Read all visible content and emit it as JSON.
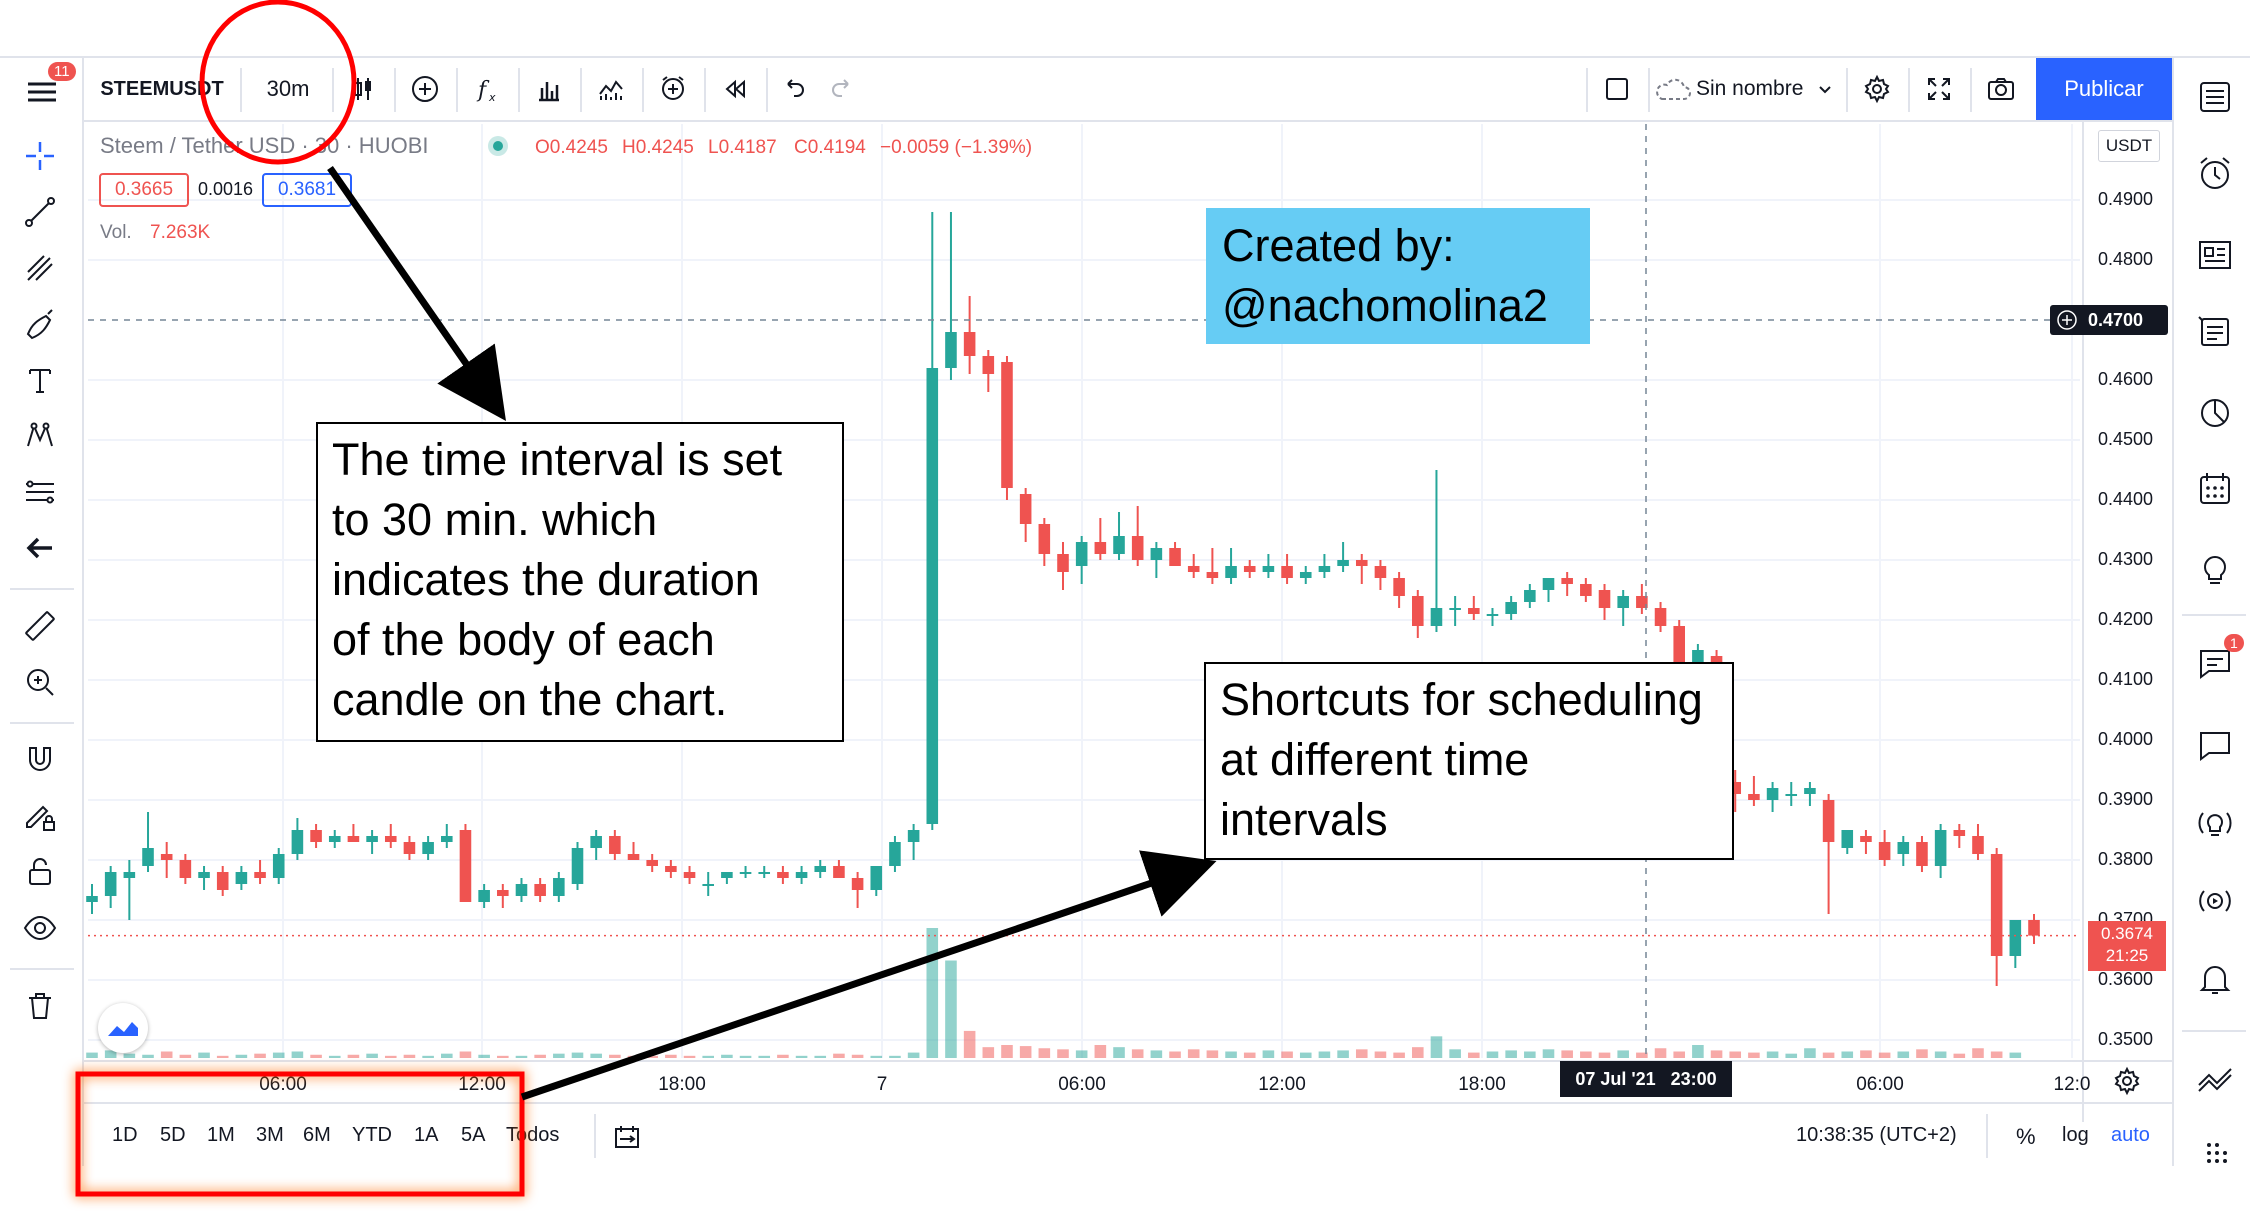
{
  "toolbar": {
    "symbol": "STEEMUSDT",
    "interval": "30m",
    "layout_name": "Sin nombre",
    "publish_label": "Publicar",
    "notification_badge": "11"
  },
  "legend": {
    "title": "Steem / Tether USD · 30 · HUOBI",
    "open": "O0.4245",
    "high": "H0.4245",
    "low": "L0.4187",
    "close": "C0.4194",
    "change": "−0.0059 (−1.39%)",
    "bid": "0.3665",
    "spread": "0.0016",
    "ask": "0.3681",
    "volume_label": "Vol.",
    "volume_value": "7.263K"
  },
  "price_axis": {
    "currency": "USDT",
    "ticks": [
      "0.4900",
      "0.4800",
      "0.4600",
      "0.4500",
      "0.4400",
      "0.4300",
      "0.4200",
      "0.4100",
      "0.4000",
      "0.3900",
      "0.3800",
      "0.3700",
      "0.3600",
      "0.3500"
    ],
    "crosshair_price": "0.4700",
    "last_price": "0.3674",
    "countdown": "21:25"
  },
  "time_axis": {
    "ticks": [
      "06:00",
      "12:00",
      "18:00",
      "7",
      "06:00",
      "12:00",
      "18:00",
      "06:00",
      "12:0"
    ],
    "crosshair_time": "07 Jul '21   23:00"
  },
  "bottom_bar": {
    "ranges": [
      "1D",
      "5D",
      "1M",
      "3M",
      "6M",
      "YTD",
      "1A",
      "5A",
      "Todos"
    ],
    "clock": "10:38:35 (UTC+2)",
    "percent": "%",
    "log": "log",
    "auto": "auto"
  },
  "right_badge": "1",
  "annotations": {
    "created_by": [
      "Created by:",
      "@nachomolina2"
    ],
    "interval_note": [
      "The time interval is set",
      "to 30 min. which",
      "indicates the duration",
      "of the body of each",
      "candle on the chart."
    ],
    "shortcuts_note": [
      "Shortcuts for scheduling",
      "at different time",
      "intervals"
    ]
  },
  "colors": {
    "up": "#26a69a",
    "down": "#ef5350",
    "accent": "#2962ff",
    "annotation_fill": "#66ccf4"
  },
  "chart_data": {
    "type": "candlestick",
    "symbol": "STEEMUSDT",
    "interval": "30m",
    "ylim": [
      0.345,
      0.5
    ],
    "candles": [
      [
        0.373,
        0.376,
        0.371,
        0.374
      ],
      [
        0.374,
        0.379,
        0.372,
        0.378
      ],
      [
        0.377,
        0.38,
        0.37,
        0.378
      ],
      [
        0.379,
        0.388,
        0.378,
        0.382
      ],
      [
        0.381,
        0.383,
        0.377,
        0.38
      ],
      [
        0.38,
        0.381,
        0.376,
        0.377
      ],
      [
        0.377,
        0.379,
        0.375,
        0.378
      ],
      [
        0.378,
        0.379,
        0.374,
        0.375
      ],
      [
        0.376,
        0.379,
        0.375,
        0.378
      ],
      [
        0.378,
        0.38,
        0.376,
        0.377
      ],
      [
        0.377,
        0.382,
        0.376,
        0.381
      ],
      [
        0.381,
        0.387,
        0.38,
        0.385
      ],
      [
        0.385,
        0.386,
        0.382,
        0.383
      ],
      [
        0.383,
        0.385,
        0.382,
        0.384
      ],
      [
        0.384,
        0.386,
        0.383,
        0.383
      ],
      [
        0.383,
        0.385,
        0.381,
        0.384
      ],
      [
        0.384,
        0.386,
        0.382,
        0.383
      ],
      [
        0.383,
        0.384,
        0.38,
        0.381
      ],
      [
        0.381,
        0.384,
        0.38,
        0.383
      ],
      [
        0.383,
        0.386,
        0.382,
        0.384
      ],
      [
        0.385,
        0.386,
        0.373,
        0.373
      ],
      [
        0.373,
        0.376,
        0.372,
        0.375
      ],
      [
        0.375,
        0.376,
        0.372,
        0.374
      ],
      [
        0.374,
        0.377,
        0.373,
        0.376
      ],
      [
        0.376,
        0.377,
        0.373,
        0.374
      ],
      [
        0.374,
        0.378,
        0.373,
        0.377
      ],
      [
        0.376,
        0.383,
        0.375,
        0.382
      ],
      [
        0.382,
        0.385,
        0.38,
        0.384
      ],
      [
        0.384,
        0.385,
        0.38,
        0.381
      ],
      [
        0.381,
        0.383,
        0.38,
        0.38
      ],
      [
        0.38,
        0.381,
        0.378,
        0.379
      ],
      [
        0.379,
        0.38,
        0.377,
        0.378
      ],
      [
        0.378,
        0.379,
        0.376,
        0.377
      ],
      [
        0.376,
        0.378,
        0.374,
        0.376
      ],
      [
        0.377,
        0.378,
        0.376,
        0.378
      ],
      [
        0.378,
        0.379,
        0.377,
        0.378
      ],
      [
        0.378,
        0.379,
        0.377,
        0.378
      ],
      [
        0.378,
        0.379,
        0.376,
        0.377
      ],
      [
        0.377,
        0.379,
        0.376,
        0.378
      ],
      [
        0.378,
        0.38,
        0.377,
        0.379
      ],
      [
        0.379,
        0.38,
        0.377,
        0.377
      ],
      [
        0.377,
        0.378,
        0.372,
        0.375
      ],
      [
        0.375,
        0.379,
        0.374,
        0.379
      ],
      [
        0.379,
        0.384,
        0.378,
        0.383
      ],
      [
        0.383,
        0.386,
        0.38,
        0.385
      ],
      [
        0.386,
        0.488,
        0.385,
        0.462
      ],
      [
        0.462,
        0.488,
        0.46,
        0.468
      ],
      [
        0.468,
        0.474,
        0.461,
        0.464
      ],
      [
        0.464,
        0.465,
        0.458,
        0.461
      ],
      [
        0.463,
        0.464,
        0.44,
        0.442
      ],
      [
        0.441,
        0.442,
        0.433,
        0.436
      ],
      [
        0.436,
        0.437,
        0.429,
        0.431
      ],
      [
        0.431,
        0.433,
        0.425,
        0.428
      ],
      [
        0.429,
        0.434,
        0.426,
        0.433
      ],
      [
        0.433,
        0.437,
        0.43,
        0.431
      ],
      [
        0.431,
        0.438,
        0.43,
        0.434
      ],
      [
        0.434,
        0.439,
        0.429,
        0.43
      ],
      [
        0.43,
        0.433,
        0.427,
        0.432
      ],
      [
        0.432,
        0.433,
        0.429,
        0.429
      ],
      [
        0.429,
        0.431,
        0.427,
        0.428
      ],
      [
        0.428,
        0.432,
        0.426,
        0.427
      ],
      [
        0.427,
        0.432,
        0.426,
        0.429
      ],
      [
        0.429,
        0.43,
        0.427,
        0.428
      ],
      [
        0.428,
        0.431,
        0.427,
        0.429
      ],
      [
        0.429,
        0.431,
        0.426,
        0.427
      ],
      [
        0.427,
        0.429,
        0.426,
        0.428
      ],
      [
        0.428,
        0.431,
        0.427,
        0.429
      ],
      [
        0.429,
        0.433,
        0.428,
        0.43
      ],
      [
        0.43,
        0.431,
        0.426,
        0.429
      ],
      [
        0.429,
        0.43,
        0.425,
        0.427
      ],
      [
        0.427,
        0.428,
        0.422,
        0.424
      ],
      [
        0.424,
        0.425,
        0.417,
        0.419
      ],
      [
        0.419,
        0.445,
        0.418,
        0.422
      ],
      [
        0.422,
        0.424,
        0.419,
        0.422
      ],
      [
        0.422,
        0.424,
        0.42,
        0.421
      ],
      [
        0.421,
        0.422,
        0.419,
        0.421
      ],
      [
        0.421,
        0.424,
        0.42,
        0.423
      ],
      [
        0.423,
        0.426,
        0.422,
        0.425
      ],
      [
        0.425,
        0.427,
        0.423,
        0.427
      ],
      [
        0.427,
        0.428,
        0.424,
        0.426
      ],
      [
        0.426,
        0.427,
        0.423,
        0.424
      ],
      [
        0.425,
        0.426,
        0.42,
        0.422
      ],
      [
        0.422,
        0.425,
        0.419,
        0.424
      ],
      [
        0.424,
        0.426,
        0.421,
        0.422
      ],
      [
        0.422,
        0.423,
        0.418,
        0.419
      ],
      [
        0.419,
        0.42,
        0.411,
        0.413
      ],
      [
        0.412,
        0.416,
        0.41,
        0.415
      ],
      [
        0.414,
        0.415,
        0.392,
        0.394
      ],
      [
        0.393,
        0.395,
        0.388,
        0.391
      ],
      [
        0.391,
        0.394,
        0.389,
        0.39
      ],
      [
        0.39,
        0.393,
        0.388,
        0.392
      ],
      [
        0.391,
        0.393,
        0.389,
        0.391
      ],
      [
        0.391,
        0.393,
        0.389,
        0.392
      ],
      [
        0.39,
        0.391,
        0.371,
        0.383
      ],
      [
        0.382,
        0.385,
        0.381,
        0.385
      ],
      [
        0.384,
        0.385,
        0.381,
        0.383
      ],
      [
        0.383,
        0.385,
        0.379,
        0.38
      ],
      [
        0.381,
        0.384,
        0.379,
        0.383
      ],
      [
        0.383,
        0.384,
        0.378,
        0.379
      ],
      [
        0.379,
        0.386,
        0.377,
        0.385
      ],
      [
        0.385,
        0.386,
        0.382,
        0.384
      ],
      [
        0.384,
        0.386,
        0.38,
        0.381
      ],
      [
        0.381,
        0.382,
        0.359,
        0.364
      ],
      [
        0.364,
        0.37,
        0.362,
        0.37
      ],
      [
        0.37,
        0.371,
        0.366,
        0.3674
      ]
    ],
    "volume": [
      5,
      7,
      4,
      3,
      6,
      3,
      5,
      2,
      3,
      4,
      5,
      6,
      3,
      2,
      3,
      4,
      2,
      3,
      2,
      4,
      6,
      3,
      2,
      2,
      3,
      4,
      5,
      4,
      3,
      2,
      2,
      3,
      2,
      2,
      3,
      2,
      2,
      3,
      2,
      2,
      4,
      3,
      2,
      2,
      5,
      120,
      90,
      25,
      10,
      12,
      11,
      9,
      8,
      7,
      12,
      10,
      8,
      7,
      6,
      8,
      7,
      6,
      5,
      7,
      6,
      5,
      6,
      7,
      8,
      6,
      5,
      10,
      20,
      8,
      5,
      6,
      7,
      6,
      8,
      7,
      6,
      5,
      7,
      5,
      9,
      6,
      12,
      7,
      6,
      5,
      6,
      4,
      9,
      5,
      6,
      7,
      5,
      6,
      8,
      6,
      4,
      9,
      6,
      5
    ]
  }
}
